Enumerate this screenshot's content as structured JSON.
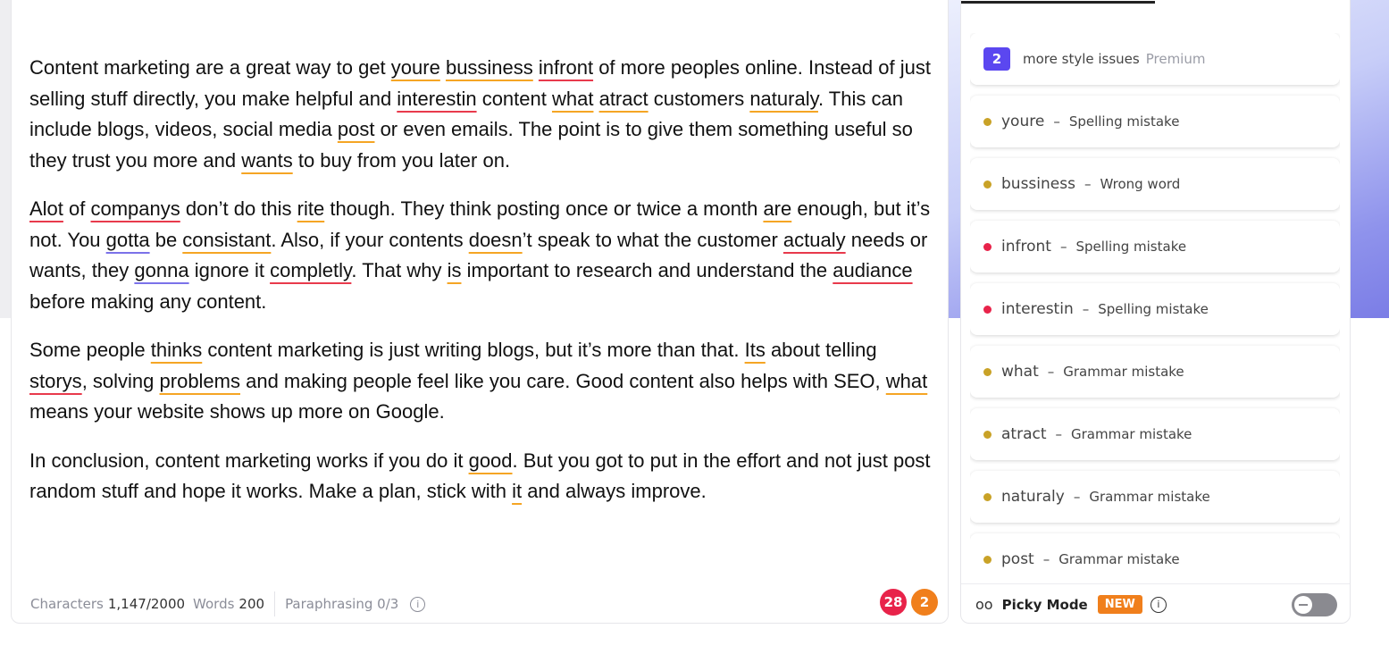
{
  "editor": {
    "paragraphs": [
      [
        {
          "t": "Content marketing are a great way to get "
        },
        {
          "t": "youre",
          "u": "y"
        },
        {
          "t": " "
        },
        {
          "t": "bussiness",
          "u": "y"
        },
        {
          "t": " "
        },
        {
          "t": "infront",
          "u": "r"
        },
        {
          "t": " of more peoples online. Instead of just selling stuff directly, you make helpful and "
        },
        {
          "t": "interestin",
          "u": "r"
        },
        {
          "t": " content "
        },
        {
          "t": "what",
          "u": "y"
        },
        {
          "t": " "
        },
        {
          "t": "atract",
          "u": "y"
        },
        {
          "t": " customers "
        },
        {
          "t": "naturaly",
          "u": "y"
        },
        {
          "t": ". This can include blogs, videos, social media "
        },
        {
          "t": "post",
          "u": "y"
        },
        {
          "t": " or even emails. The point is to give them something useful so they trust you more and "
        },
        {
          "t": "wants",
          "u": "y"
        },
        {
          "t": " to buy from you later on."
        }
      ],
      [
        {
          "t": "Alot",
          "u": "r"
        },
        {
          "t": " of "
        },
        {
          "t": "companys",
          "u": "r"
        },
        {
          "t": " don’t do this "
        },
        {
          "t": "rite",
          "u": "y"
        },
        {
          "t": " though. They think posting once or twice a month "
        },
        {
          "t": "are",
          "u": "y"
        },
        {
          "t": " enough, but it’s not. You "
        },
        {
          "t": "gotta",
          "u": "b"
        },
        {
          "t": " be "
        },
        {
          "t": "consistant",
          "u": "y"
        },
        {
          "t": ". Also, if your contents "
        },
        {
          "t": "doesn",
          "u": "y"
        },
        {
          "t": "’t speak to what the customer "
        },
        {
          "t": "actualy",
          "u": "r"
        },
        {
          "t": " needs or wants, they "
        },
        {
          "t": "gonna",
          "u": "b"
        },
        {
          "t": " ignore it "
        },
        {
          "t": "completly",
          "u": "r"
        },
        {
          "t": ". That why "
        },
        {
          "t": "is",
          "u": "y"
        },
        {
          "t": " important to research and understand the "
        },
        {
          "t": "audiance",
          "u": "r"
        },
        {
          "t": " before making any content."
        }
      ],
      [
        {
          "t": "Some people "
        },
        {
          "t": "thinks",
          "u": "y"
        },
        {
          "t": " content marketing is just writing blogs, but it’s more than that. "
        },
        {
          "t": "Its",
          "u": "y"
        },
        {
          "t": " about telling "
        },
        {
          "t": "storys",
          "u": "r"
        },
        {
          "t": ", solving "
        },
        {
          "t": "problems",
          "u": "y"
        },
        {
          "t": " and making people feel like you care. Good content also helps with SEO, "
        },
        {
          "t": "what",
          "u": "y"
        },
        {
          "t": " means your website shows up more on Google."
        }
      ],
      [
        {
          "t": "In conclusion, content marketing works if you do it "
        },
        {
          "t": "good",
          "u": "y"
        },
        {
          "t": ". But you got to put in the effort and not just post random stuff and hope it works. Make a plan, stick with "
        },
        {
          "t": "it",
          "u": "y"
        },
        {
          "t": " and always improve."
        }
      ]
    ],
    "footer": {
      "characters_label": "Characters",
      "characters_value": "1,147/2000",
      "words_label": "Words",
      "words_value": "200",
      "paraphrasing": "Paraphrasing 0/3",
      "info_glyph": "i"
    },
    "badges": {
      "errors": "28",
      "style": "2"
    }
  },
  "panel": {
    "premium_card": {
      "count": "2",
      "label": "more style issues",
      "premium": "Premium"
    },
    "issues": [
      {
        "word": "youre",
        "type": "Spelling mistake",
        "severity": "y"
      },
      {
        "word": "bussiness",
        "type": "Wrong word",
        "severity": "y"
      },
      {
        "word": "infront",
        "type": "Spelling mistake",
        "severity": "r"
      },
      {
        "word": "interestin",
        "type": "Spelling mistake",
        "severity": "r"
      },
      {
        "word": "what",
        "type": "Grammar mistake",
        "severity": "y"
      },
      {
        "word": "atract",
        "type": "Grammar mistake",
        "severity": "y"
      },
      {
        "word": "naturaly",
        "type": "Grammar mistake",
        "severity": "y"
      },
      {
        "word": "post",
        "type": "Grammar mistake",
        "severity": "y"
      }
    ],
    "dash": "–",
    "picky": {
      "glasses_glyph": "oo",
      "label": "Picky Mode",
      "new_badge": "NEW",
      "info_glyph": "i"
    }
  },
  "colors": {
    "error": "#e8234a",
    "warning": "#f5a524",
    "style": "#7b72e9",
    "accent": "#5b47f0",
    "new": "#f07f1c"
  }
}
